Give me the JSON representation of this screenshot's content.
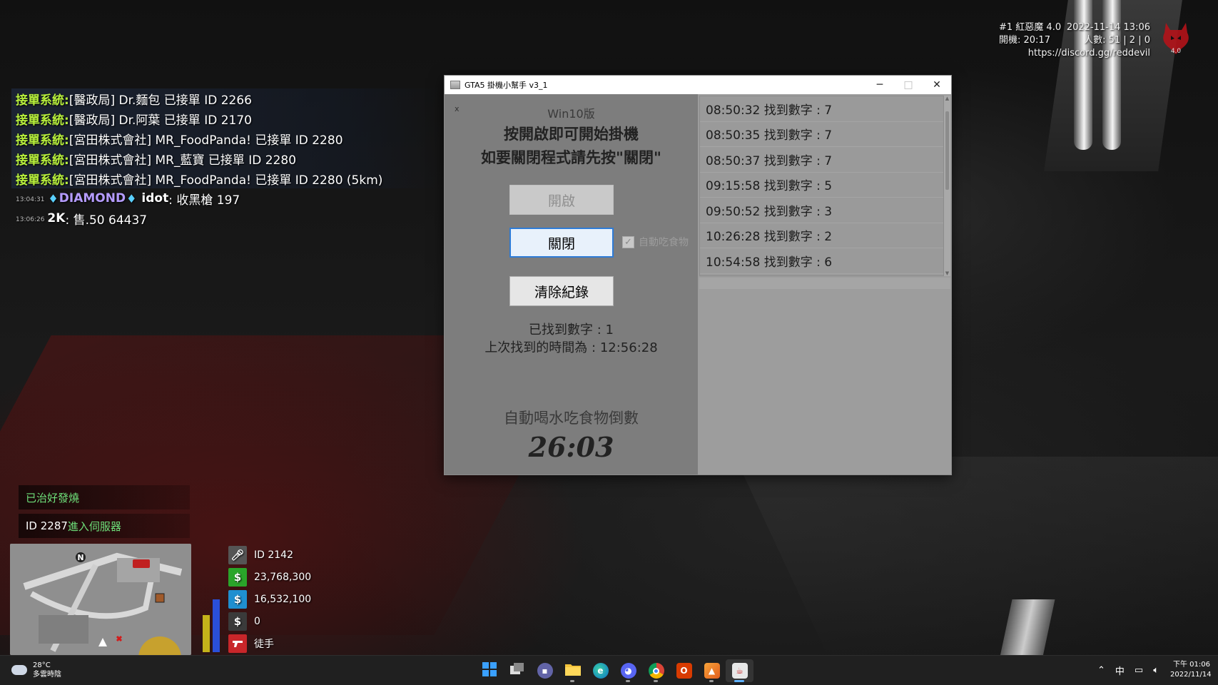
{
  "hud": {
    "server_line1_left": "#1 紅惡魔 4.0",
    "server_line1_right": "2022-11-14 13:06",
    "server_line2_left": "開機: 20:17",
    "server_line2_right": "人數: 51 | 2 | 0",
    "server_url": "https://discord.gg/reddevil",
    "logo_text": "4.0"
  },
  "chat": {
    "lines": [
      {
        "prefix": "接單系統:",
        "msg": " [醫政局] Dr.麵包 已接單 ID 2266"
      },
      {
        "prefix": "接單系統:",
        "msg": " [醫政局] Dr.阿葉 已接單 ID 2170"
      },
      {
        "prefix": "接單系統:",
        "msg": " [宮田株式會社] MR_FoodPanda! 已接單 ID 2280"
      },
      {
        "prefix": "接單系統:",
        "msg": " [宮田株式會社] MR_藍寶 已接單 ID 2280"
      },
      {
        "prefix": "接單系統:",
        "msg": " [宮田株式會社] MR_FoodPanda! 已接單 ID 2280 (5km)"
      }
    ],
    "diamond_line": {
      "time": "13:04:31",
      "tag": "DIAMOND",
      "user": "idot",
      "msg": ": 收黑槍 197"
    },
    "sale_line": {
      "time": "13:06:26",
      "user": "2K",
      "msg": ": 售.50 64437"
    }
  },
  "notifications": {
    "cured": "已治好發燒",
    "join_id": "ID 2287",
    "join_text": " 進入伺服器"
  },
  "minimap": {
    "north": "N"
  },
  "stats": {
    "player_id": "ID 2142",
    "cash": "23,768,300",
    "bank": "16,532,100",
    "dirty": "0",
    "weapon": "徒手",
    "colors": {
      "cash": "#2aa52a",
      "bank": "#1f8fd0",
      "dirty": "#3a3a3a",
      "weapon": "#c8262a",
      "mic": "#555555"
    }
  },
  "window": {
    "title": "GTA5  掛機小幫手 v3_1",
    "minimize": "─",
    "maximize": "□",
    "close": "✕",
    "mini_close": "x",
    "version": "Win10版",
    "instruction_line1": "按開啟即可開始掛機",
    "instruction_line2": "如要關閉程式請先按\"關閉\"",
    "open_button": "開啟",
    "close_button": "關閉",
    "checkbox_label": "自動吃食物",
    "checkbox_checked": true,
    "clear_button": "清除紀錄",
    "found_count": "已找到數字 : 1",
    "last_found_time": "上次找到的時間為 : 12:56:28",
    "countdown_label": "自動喝水吃食物倒數",
    "countdown_value": "26:03",
    "log_items": [
      "08:50:32 找到數字 : 7",
      "08:50:35 找到數字 : 7",
      "08:50:37 找到數字 : 7",
      "09:15:58 找到數字 : 5",
      "09:50:52 找到數字 : 3",
      "10:26:28 找到數字 : 2",
      "10:54:58 找到數字 : 6"
    ]
  },
  "taskbar": {
    "temperature": "28°C",
    "weather": "多雲時陰",
    "apps": [
      "start",
      "task-view",
      "teams-chat",
      "file-explorer",
      "edge",
      "discord",
      "chrome",
      "office",
      "app-orange",
      "java-app"
    ],
    "ime": "中",
    "time": "下午 01:06",
    "date": "2022/11/14"
  }
}
